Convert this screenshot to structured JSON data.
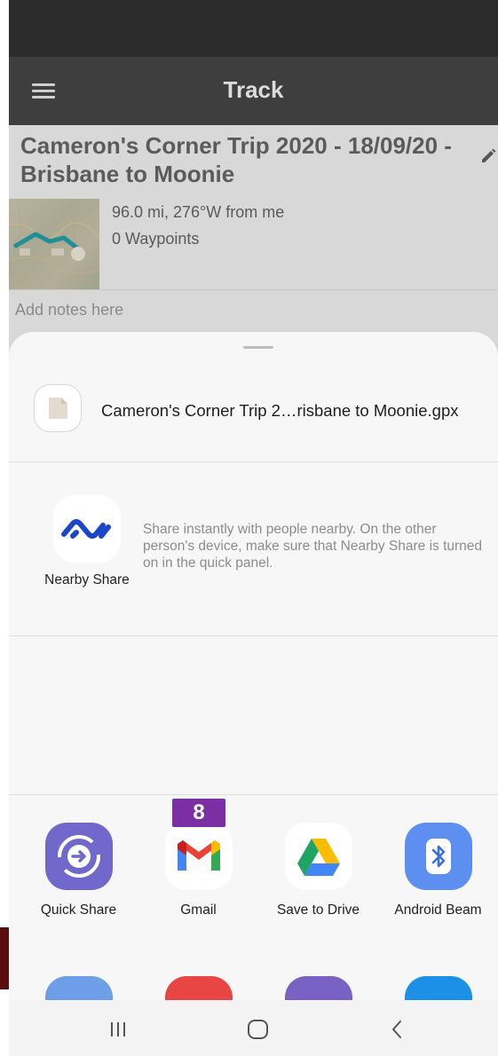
{
  "app_bar": {
    "title": "Track",
    "menu_icon": "hamburger-menu-icon"
  },
  "track": {
    "title": "Cameron's Corner Trip 2020 - 18/09/20 - Brisbane to Moonie",
    "distance": "96.0 mi, 276°W from me",
    "waypoints": "0 Waypoints",
    "notes_placeholder": "Add notes here",
    "edit_icon": "pencil-icon"
  },
  "share_sheet": {
    "file_name": "Cameron's Corner Trip 2…risbane to Moonie.gpx",
    "file_icon": "document-icon",
    "nearby": {
      "label": "Nearby Share",
      "description": "Share instantly with people nearby. On the other person's device, make sure that Nearby Share is turned on in the quick panel.",
      "icon": "nearby-share-icon",
      "color": "#1a47c7"
    },
    "apps": [
      {
        "label": "Quick Share",
        "icon": "quick-share-icon",
        "color": "#6e66c9"
      },
      {
        "label": "Gmail",
        "icon": "gmail-icon",
        "color": "#ea4335",
        "badge": "8"
      },
      {
        "label": "Save to Drive",
        "icon": "google-drive-icon",
        "color": "#1fa463"
      },
      {
        "label": "Android Beam",
        "icon": "bluetooth-icon",
        "color": "#5b8def"
      }
    ],
    "badge_color": "#7b2fa3"
  },
  "nav": {
    "recents_icon": "recents-icon",
    "home_icon": "home-icon",
    "back_icon": "back-icon"
  }
}
